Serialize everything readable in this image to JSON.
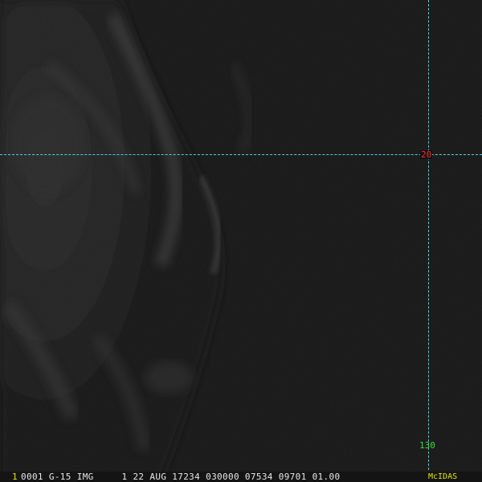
{
  "image": {
    "description_colors": {
      "background": "#161616",
      "grid": "#3fd6e6",
      "latitude_label": "#ff2a2a",
      "longitude_label": "#33e033",
      "frame_number": "#e6e600",
      "brand": "#e6e600",
      "status_text": "#e8e8e8"
    }
  },
  "grid": {
    "latitude_label": "20",
    "longitude_label": "130"
  },
  "status_bar": {
    "frame_number": "1",
    "text": "0001 G-15 IMG     1 22 AUG 17234 030000 07534 09701 01.00",
    "brand": "McIDAS"
  }
}
